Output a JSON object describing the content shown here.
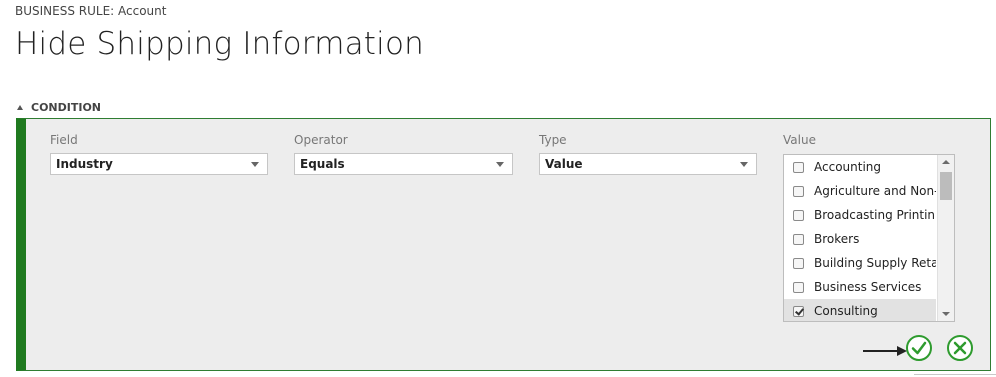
{
  "header": {
    "breadcrumb": "BUSINESS RULE: Account",
    "title": "Hide Shipping Information"
  },
  "condition": {
    "section_label": "CONDITION",
    "field": {
      "label": "Field",
      "value": "Industry"
    },
    "operator": {
      "label": "Operator",
      "value": "Equals"
    },
    "type": {
      "label": "Type",
      "value": "Value"
    },
    "value": {
      "label": "Value",
      "items": [
        {
          "label": "Accounting",
          "checked": false
        },
        {
          "label": "Agriculture and Non-...",
          "checked": false
        },
        {
          "label": "Broadcasting Printin...",
          "checked": false
        },
        {
          "label": "Brokers",
          "checked": false
        },
        {
          "label": "Building Supply Retail",
          "checked": false
        },
        {
          "label": "Business Services",
          "checked": false
        },
        {
          "label": "Consulting",
          "checked": true
        }
      ]
    },
    "actions": {
      "confirm_icon": "check-circle-icon",
      "cancel_icon": "x-circle-icon"
    },
    "colors": {
      "accent_green": "#1f7a1f",
      "button_green": "#2e9b2e"
    }
  }
}
